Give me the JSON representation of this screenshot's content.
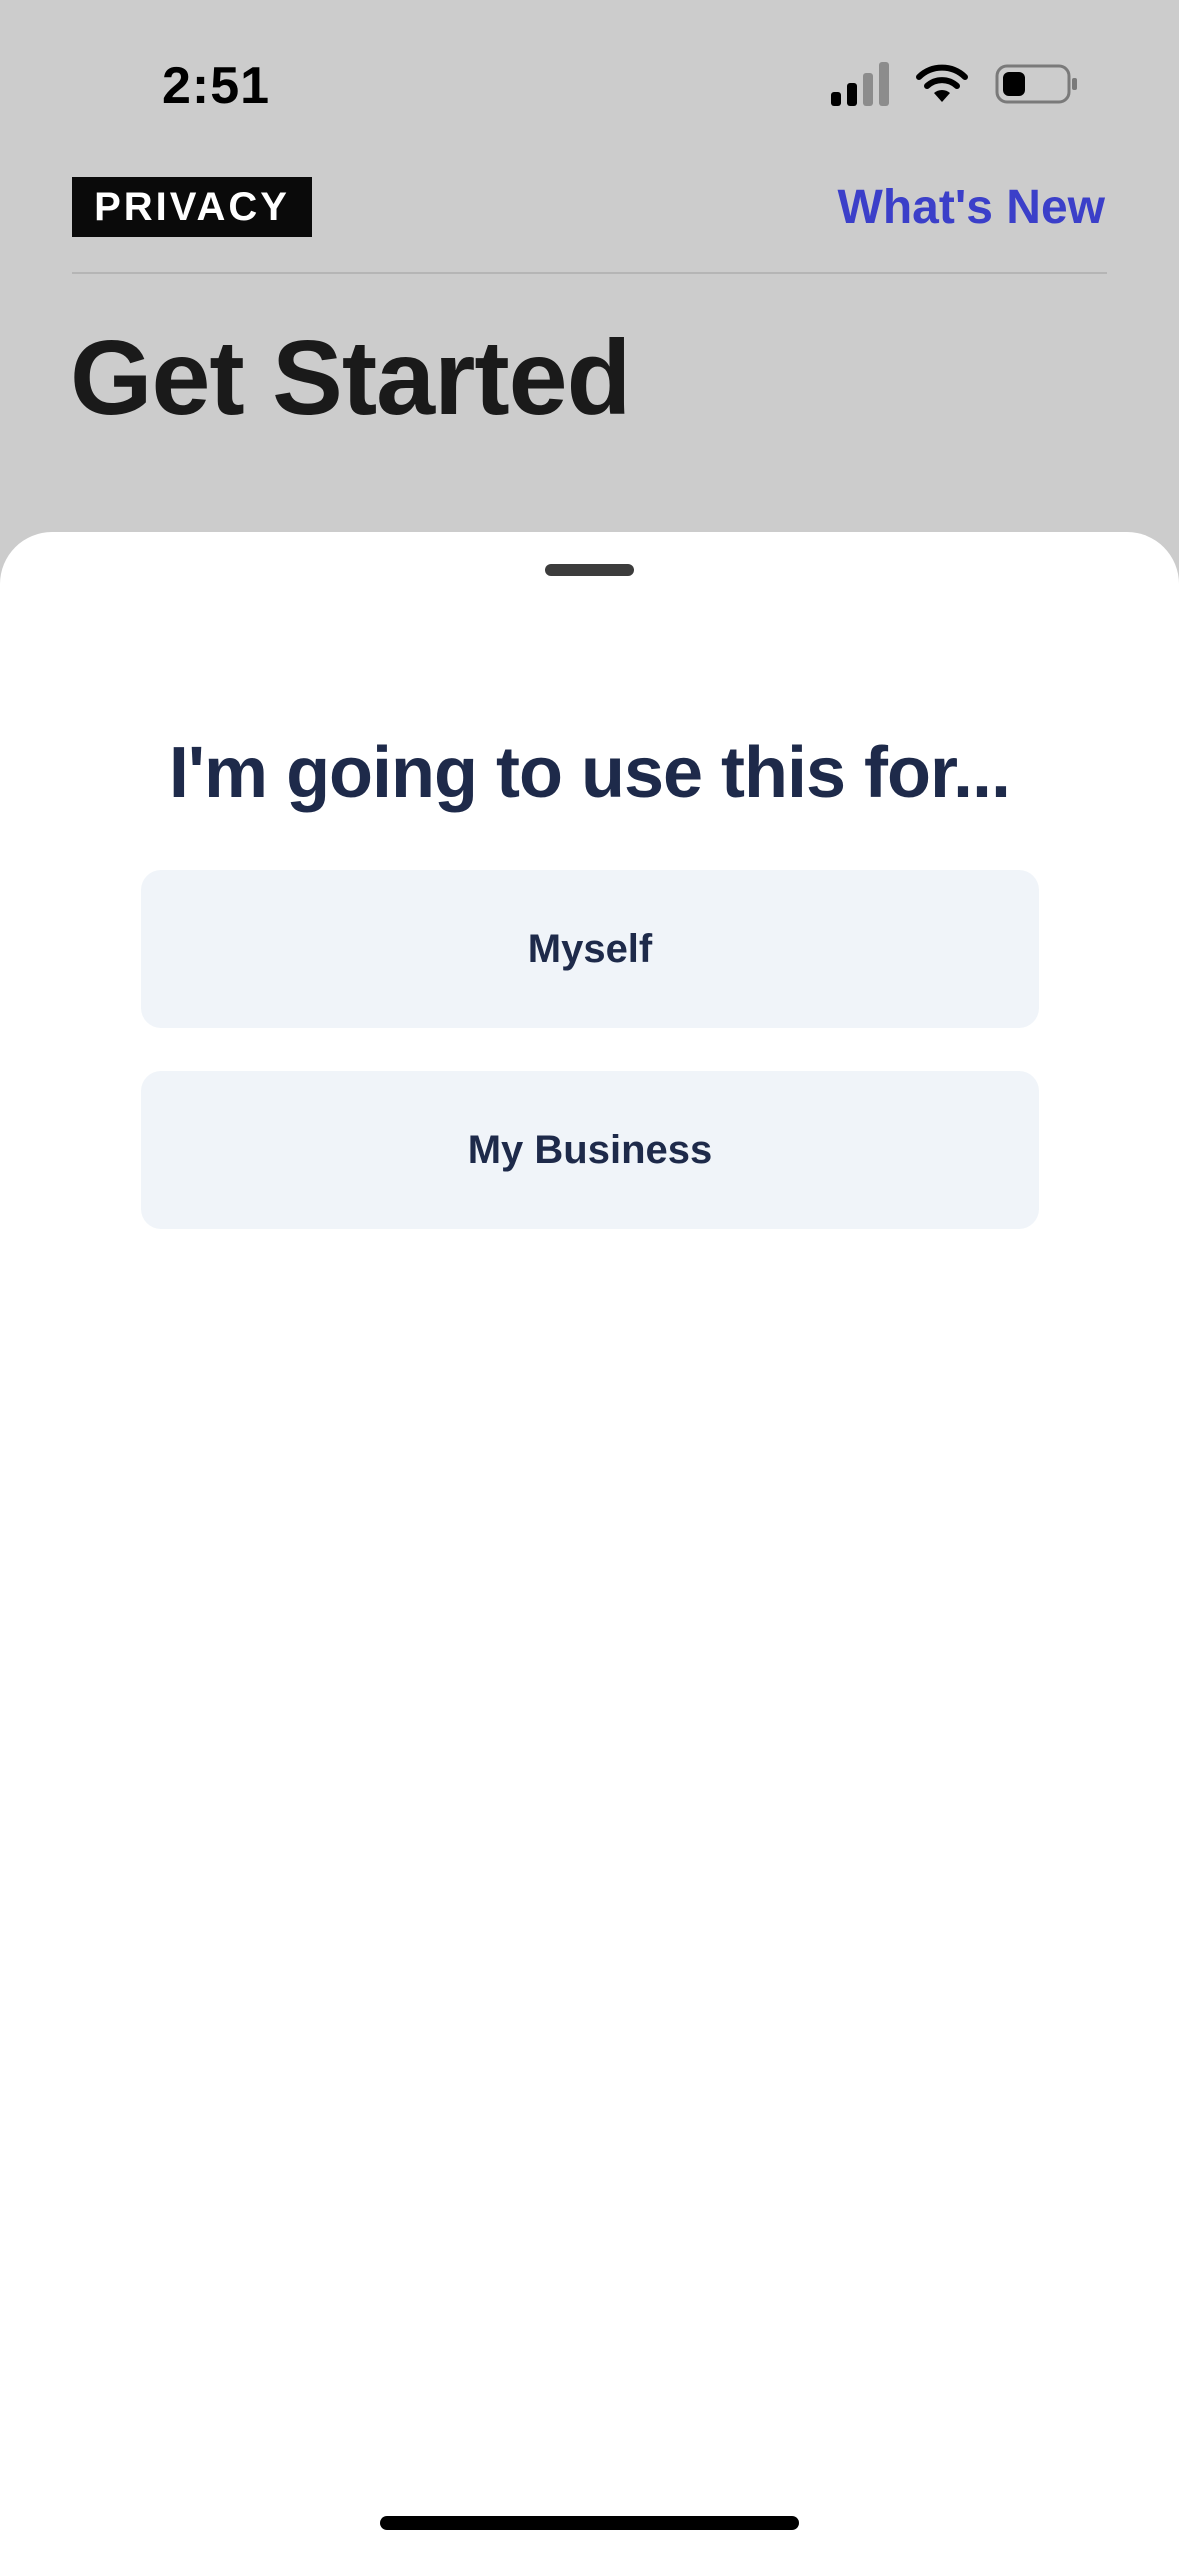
{
  "status_bar": {
    "time": "2:51",
    "icons": [
      "signal-icon",
      "wifi-icon",
      "battery-icon"
    ]
  },
  "header": {
    "logo_text": "PRIVACY",
    "whats_new_label": "What's New",
    "title": "Get Started"
  },
  "sheet": {
    "heading": "I'm going to use this for...",
    "options": [
      {
        "label": "Myself"
      },
      {
        "label": "My Business"
      }
    ]
  },
  "colors": {
    "accent_link": "#3b3fc9",
    "heading_navy": "#1e2a4a",
    "option_background": "#f0f4f9",
    "backdrop": "#cccccc"
  }
}
